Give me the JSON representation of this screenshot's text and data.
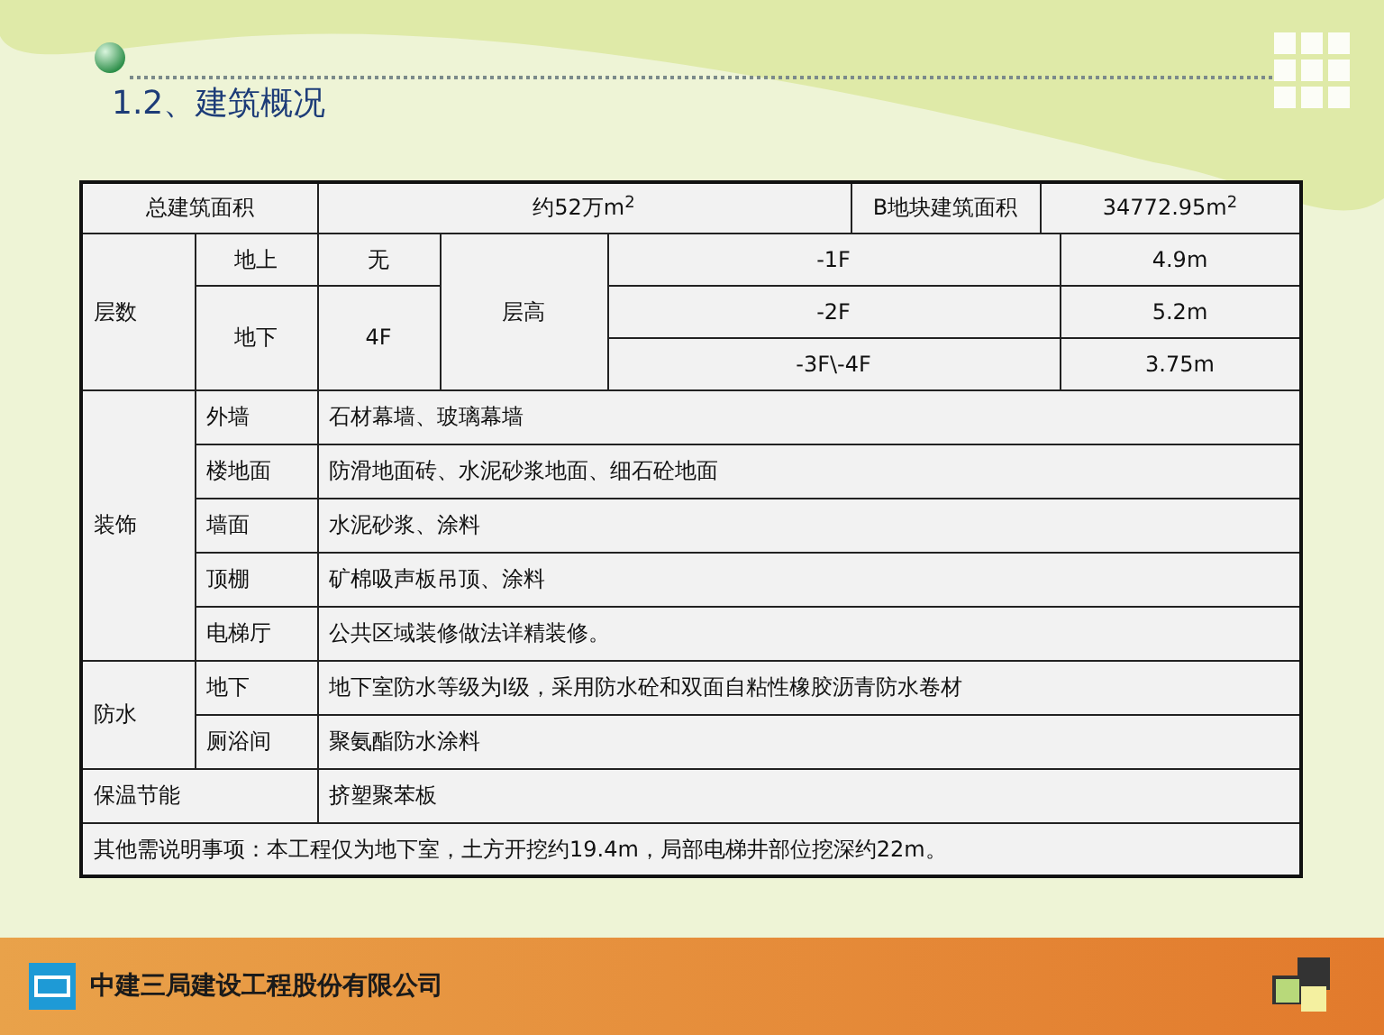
{
  "title": "1.2、建筑概况",
  "summary": {
    "total_label": "总建筑面积",
    "total_value": "约52万m$^{2}$",
    "plot_label": "B地块建筑面积",
    "plot_value": "34772.95m$^{2}$"
  },
  "floors": {
    "label": "层数",
    "above_label": "地上",
    "above_value": "无",
    "below_label": "地下",
    "below_value": "4F",
    "height_label": "层高",
    "heights": [
      {
        "floor": "-1F",
        "height": "4.9m"
      },
      {
        "floor": "-2F",
        "height": "5.2m"
      },
      {
        "floor": "-3F\\-4F",
        "height": "3.75m"
      }
    ]
  },
  "decoration": {
    "label": "装饰",
    "items": [
      {
        "part": "外墙",
        "finish": "石材幕墙、玻璃幕墙"
      },
      {
        "part": "楼地面",
        "finish": "防滑地面砖、水泥砂浆地面、细石砼地面"
      },
      {
        "part": "墙面",
        "finish": "水泥砂浆、涂料"
      },
      {
        "part": "顶棚",
        "finish": "矿棉吸声板吊顶、涂料"
      },
      {
        "part": "电梯厅",
        "finish": "公共区域装修做法详精装修。"
      }
    ]
  },
  "waterproofing": {
    "label": "防水",
    "items": [
      {
        "part": "地下",
        "finish": "地下室防水等级为I级，采用防水砼和双面自粘性橡胶沥青防水卷材"
      },
      {
        "part": "厕浴间",
        "finish": "聚氨酯防水涂料"
      }
    ]
  },
  "insulation": {
    "label": "保温节能",
    "value": "挤塑聚苯板"
  },
  "note": "其他需说明事项：本工程仅为地下室，土方开挖约19.4m，局部电梯井部位挖深约22m。",
  "footer": {
    "company": "中建三局建设工程股份有限公司"
  }
}
